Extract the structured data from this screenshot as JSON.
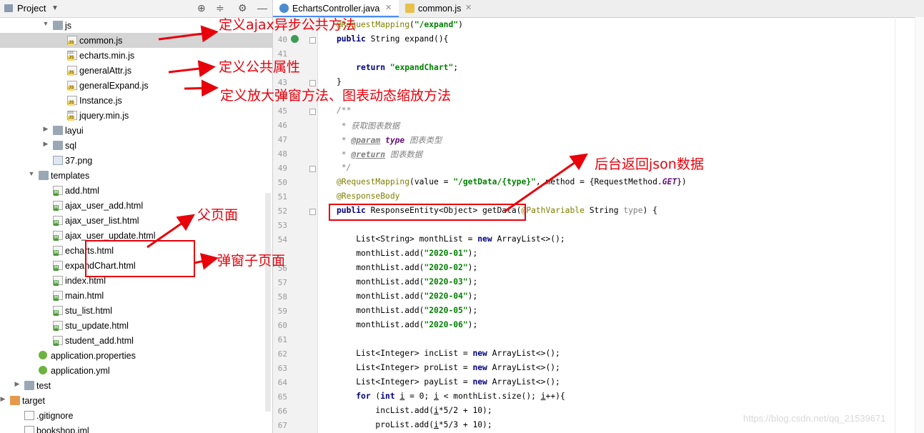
{
  "project_panel": {
    "title": "Project",
    "title_dropdown_icon": "chevron-down-icon",
    "header_icons": [
      "crosshair-icon",
      "collapse-all-icon",
      "gear-icon",
      "hide-icon"
    ],
    "tree": [
      {
        "label": "js",
        "type": "folder",
        "expanded": true
      },
      {
        "label": "common.js",
        "type": "js",
        "selected": true
      },
      {
        "label": "echarts.min.js",
        "type": "min-js"
      },
      {
        "label": "generalAttr.js",
        "type": "js"
      },
      {
        "label": "generalExpand.js",
        "type": "js"
      },
      {
        "label": "Instance.js",
        "type": "js"
      },
      {
        "label": "jquery.min.js",
        "type": "min-js"
      },
      {
        "label": "layui",
        "type": "folder",
        "expanded": false
      },
      {
        "label": "sql",
        "type": "folder",
        "expanded": false
      },
      {
        "label": "37.png",
        "type": "png"
      },
      {
        "label": "templates",
        "type": "folder",
        "expanded": true
      },
      {
        "label": "add.html",
        "type": "html"
      },
      {
        "label": "ajax_user_add.html",
        "type": "html"
      },
      {
        "label": "ajax_user_list.html",
        "type": "html"
      },
      {
        "label": "ajax_user_update.html",
        "type": "html"
      },
      {
        "label": "echarts.html",
        "type": "html"
      },
      {
        "label": "expandChart.html",
        "type": "html"
      },
      {
        "label": "index.html",
        "type": "html"
      },
      {
        "label": "main.html",
        "type": "html"
      },
      {
        "label": "stu_list.html",
        "type": "html"
      },
      {
        "label": "stu_update.html",
        "type": "html"
      },
      {
        "label": "student_add.html",
        "type": "html"
      },
      {
        "label": "application.properties",
        "type": "config"
      },
      {
        "label": "application.yml",
        "type": "config"
      },
      {
        "label": "test",
        "type": "folder",
        "expanded": false
      },
      {
        "label": "target",
        "type": "folder-orange",
        "expanded": false
      },
      {
        "label": ".gitignore",
        "type": "text"
      },
      {
        "label": "bookshop.iml",
        "type": "text"
      }
    ]
  },
  "editor": {
    "tabs": [
      {
        "label": "EchartsController.java",
        "active": true,
        "icon": "java-class-icon"
      },
      {
        "label": "common.js",
        "active": false,
        "icon": "js-file-icon"
      }
    ],
    "lines": [
      {
        "n": "",
        "html": "<span class=\"ann\">@RequestMapping</span>(<span class=\"str\">\"/expand\"</span>)"
      },
      {
        "n": "40",
        "html": "<span class=\"kw\">public</span> String expand(){"
      },
      {
        "n": "41",
        "html": ""
      },
      {
        "n": "",
        "html": "    <span class=\"kw\">return</span> <span class=\"str\">\"expandChart\"</span>;"
      },
      {
        "n": "43",
        "html": "}"
      },
      {
        "n": "44",
        "html": ""
      },
      {
        "n": "45",
        "html": "<span class=\"cmt\">/**</span>"
      },
      {
        "n": "46",
        "html": "<span class=\"cmt\"> * 获取图表数据</span>"
      },
      {
        "n": "47",
        "html": "<span class=\"cmt\"> * </span><span class=\"tag\">@param</span><span class=\"cmt\"> </span><span class=\"param\"><b>type</b></span><span class=\"cmt\"> 图表类型</span>"
      },
      {
        "n": "48",
        "html": "<span class=\"cmt\"> * </span><span class=\"tag\">@return</span><span class=\"cmt\"> 图表数据</span>"
      },
      {
        "n": "49",
        "html": "<span class=\"cmt\"> */</span>"
      },
      {
        "n": "50",
        "html": "<span class=\"ann\">@RequestMapping</span>(value = <span class=\"str\">\"/getData/{type}\"</span>, method = {RequestMethod.<span class=\"cst\">GET</span>})"
      },
      {
        "n": "51",
        "html": "<span class=\"ann\">@ResponseBody</span>"
      },
      {
        "n": "52",
        "html": "<span class=\"kw\">public</span> ResponseEntity&lt;Object&gt; getData(<span class=\"ann\">@PathVariable</span> String <span class=\"param-plain\">type</span>) {"
      },
      {
        "n": "53",
        "html": ""
      },
      {
        "n": "54",
        "html": "    List&lt;String&gt; monthList = <span class=\"kw\">new</span> ArrayList&lt;&gt;();"
      },
      {
        "n": "",
        "html": "    monthList.add(<span class=\"str\">\"2020-01\"</span>);"
      },
      {
        "n": "56",
        "html": "    monthList.add(<span class=\"str\">\"2020-02\"</span>);"
      },
      {
        "n": "57",
        "html": "    monthList.add(<span class=\"str\">\"2020-03\"</span>);"
      },
      {
        "n": "58",
        "html": "    monthList.add(<span class=\"str\">\"2020-04\"</span>);"
      },
      {
        "n": "59",
        "html": "    monthList.add(<span class=\"str\">\"2020-05\"</span>);"
      },
      {
        "n": "60",
        "html": "    monthList.add(<span class=\"str\">\"2020-06\"</span>);"
      },
      {
        "n": "61",
        "html": ""
      },
      {
        "n": "62",
        "html": "    List&lt;Integer&gt; incList = <span class=\"kw\">new</span> ArrayList&lt;&gt;();"
      },
      {
        "n": "63",
        "html": "    List&lt;Integer&gt; proList = <span class=\"kw\">new</span> ArrayList&lt;&gt;();"
      },
      {
        "n": "64",
        "html": "    List&lt;Integer&gt; payList = <span class=\"kw\">new</span> ArrayList&lt;&gt;();"
      },
      {
        "n": "65",
        "html": "    <span class=\"kw\">for</span> (<span class=\"kw\">int</span> <span class=\"uvar\">i</span> = <span class=\"num\">0</span>; <span class=\"uvar\">i</span> &lt; monthList.size(); <span class=\"uvar\">i</span>++){"
      },
      {
        "n": "66",
        "html": "        incList.add(<span class=\"uvar\">i</span>*5/2 + 10);"
      },
      {
        "n": "67",
        "html": "        proList.add(<span class=\"uvar\">i</span>*5/3 + 10);"
      }
    ]
  },
  "annotations": {
    "common_js": "定义ajax异步公共方法",
    "general_attr": "定义公共属性",
    "general_expand": "定义放大弹窗方法、图表动态缩放方法",
    "backend_json": "后台返回json数据",
    "parent_page": "父页面",
    "popup_page": "弹窗子页面",
    "color": "#e8000b"
  },
  "watermark": "https://blog.csdn.net/qq_21539671"
}
